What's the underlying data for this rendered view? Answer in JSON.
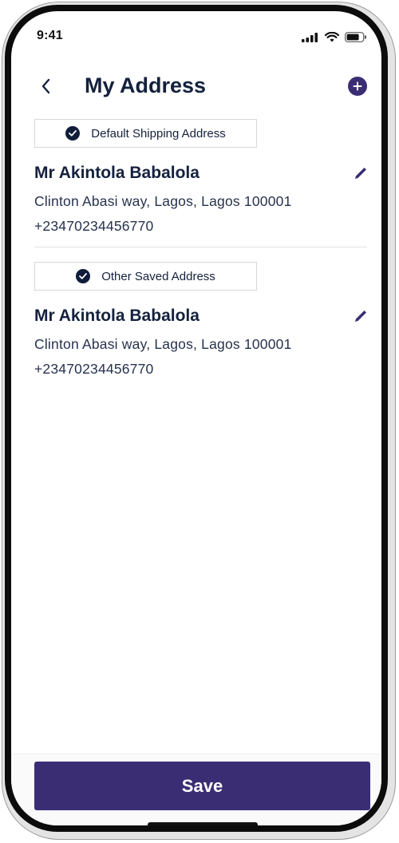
{
  "status_bar": {
    "time": "9:41"
  },
  "header": {
    "title": "My Address",
    "back_icon": "chevron-left-icon",
    "add_icon": "plus-circle-icon"
  },
  "sections": [
    {
      "tag": "Default Shipping Address",
      "name": "Mr Akintola Babalola",
      "address": "Clinton Abasi way, Lagos, Lagos 100001",
      "phone": "+23470234456770"
    },
    {
      "tag": "Other Saved Address",
      "name": "Mr Akintola Babalola",
      "address": "Clinton Abasi way, Lagos, Lagos 100001",
      "phone": "+23470234456770"
    }
  ],
  "footer": {
    "save_label": "Save"
  },
  "colors": {
    "accent": "#3b2d74",
    "text": "#14213d",
    "check": "#0f1d3b"
  }
}
